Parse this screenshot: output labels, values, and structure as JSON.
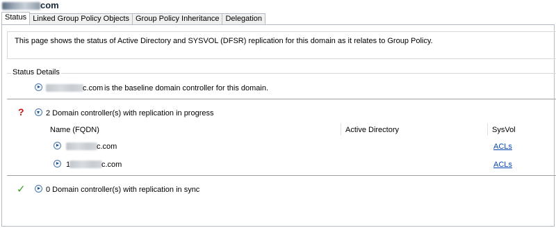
{
  "window": {
    "title_suffix": "com"
  },
  "tabs": [
    {
      "label": "Status",
      "active": true
    },
    {
      "label": "Linked Group Policy Objects"
    },
    {
      "label": "Group Policy Inheritance"
    },
    {
      "label": "Delegation"
    }
  ],
  "description": "This page shows the status of Active Directory and SYSVOL (DFSR) replication for this domain as it relates to Group Policy.",
  "status_details": {
    "label": "Status Details",
    "baseline": {
      "name_suffix": "c.com",
      "text": "is the baseline domain controller for this domain."
    },
    "in_progress": {
      "text": "2 Domain controller(s) with replication in progress",
      "columns": {
        "name": "Name (FQDN)",
        "ad": "Active Directory",
        "sysvol": "SysVol"
      },
      "rows": [
        {
          "name_suffix": "c.com",
          "sysvol_link": "ACLs"
        },
        {
          "name_prefix": "1",
          "name_suffix": "c.com",
          "sysvol_link": "ACLs"
        }
      ]
    },
    "in_sync": {
      "text": "0 Domain controller(s) with replication in sync"
    }
  },
  "icons": {
    "warning": "question-mark-icon",
    "ok": "checkmark-icon"
  },
  "colors": {
    "warning": "#cc1111",
    "ok": "#3a9d23",
    "link": "#0645ad"
  }
}
